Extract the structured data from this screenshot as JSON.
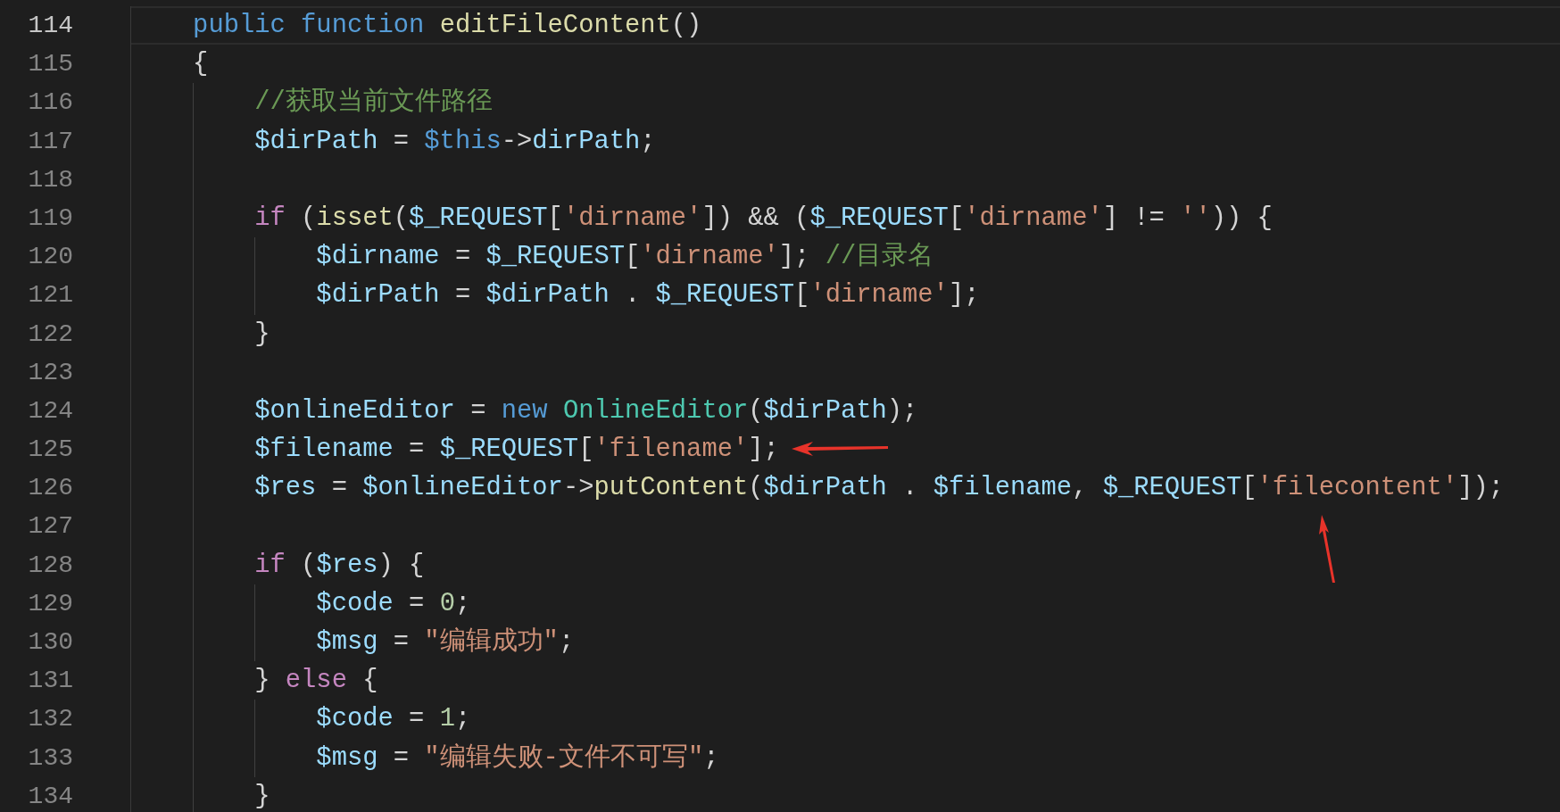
{
  "editor": {
    "lines": [
      {
        "number": "114",
        "current": true,
        "tokens": [
          {
            "text": "    public ",
            "kind": "kw"
          },
          {
            "text": "function ",
            "kind": "kw"
          },
          {
            "text": "editFileContent",
            "kind": "fn"
          },
          {
            "text": "()",
            "kind": "p"
          }
        ]
      },
      {
        "number": "115",
        "current": false,
        "tokens": [
          {
            "text": "    {",
            "kind": "p"
          }
        ]
      },
      {
        "number": "116",
        "current": false,
        "tokens": [
          {
            "text": "        //获取当前文件路径",
            "kind": "cmt"
          }
        ]
      },
      {
        "number": "117",
        "current": false,
        "tokens": [
          {
            "text": "        $dirPath",
            "kind": "var"
          },
          {
            "text": " = ",
            "kind": "p"
          },
          {
            "text": "$this",
            "kind": "kw"
          },
          {
            "text": "->",
            "kind": "p"
          },
          {
            "text": "dirPath",
            "kind": "var"
          },
          {
            "text": ";",
            "kind": "p"
          }
        ]
      },
      {
        "number": "118",
        "current": false
      },
      {
        "number": "119",
        "current": false,
        "tokens": [
          {
            "text": "        if",
            "kind": "ctl"
          },
          {
            "text": " (",
            "kind": "p"
          },
          {
            "text": "isset",
            "kind": "fn"
          },
          {
            "text": "(",
            "kind": "p"
          },
          {
            "text": "$_REQUEST",
            "kind": "var"
          },
          {
            "text": "[",
            "kind": "p"
          },
          {
            "text": "'dirname'",
            "kind": "str"
          },
          {
            "text": "]) && (",
            "kind": "p"
          },
          {
            "text": "$_REQUEST",
            "kind": "var"
          },
          {
            "text": "[",
            "kind": "p"
          },
          {
            "text": "'dirname'",
            "kind": "str"
          },
          {
            "text": "] != ",
            "kind": "p"
          },
          {
            "text": "''",
            "kind": "str"
          },
          {
            "text": ")) {",
            "kind": "p"
          }
        ]
      },
      {
        "number": "120",
        "current": false,
        "tokens": [
          {
            "text": "            $dirname",
            "kind": "var"
          },
          {
            "text": " = ",
            "kind": "p"
          },
          {
            "text": "$_REQUEST",
            "kind": "var"
          },
          {
            "text": "[",
            "kind": "p"
          },
          {
            "text": "'dirname'",
            "kind": "str"
          },
          {
            "text": "]; ",
            "kind": "p"
          },
          {
            "text": "//目录名",
            "kind": "cmt"
          }
        ]
      },
      {
        "number": "121",
        "current": false,
        "tokens": [
          {
            "text": "            $dirPath",
            "kind": "var"
          },
          {
            "text": " = ",
            "kind": "p"
          },
          {
            "text": "$dirPath",
            "kind": "var"
          },
          {
            "text": " . ",
            "kind": "p"
          },
          {
            "text": "$_REQUEST",
            "kind": "var"
          },
          {
            "text": "[",
            "kind": "p"
          },
          {
            "text": "'dirname'",
            "kind": "str"
          },
          {
            "text": "];",
            "kind": "p"
          }
        ]
      },
      {
        "number": "122",
        "current": false,
        "tokens": [
          {
            "text": "        }",
            "kind": "p"
          }
        ]
      },
      {
        "number": "123",
        "current": false
      },
      {
        "number": "124",
        "current": false,
        "tokens": [
          {
            "text": "        $onlineEditor",
            "kind": "var"
          },
          {
            "text": " = ",
            "kind": "p"
          },
          {
            "text": "new ",
            "kind": "kw"
          },
          {
            "text": "OnlineEditor",
            "kind": "cls"
          },
          {
            "text": "(",
            "kind": "p"
          },
          {
            "text": "$dirPath",
            "kind": "var"
          },
          {
            "text": ");",
            "kind": "p"
          }
        ]
      },
      {
        "number": "125",
        "current": false,
        "arrow_after": true,
        "tokens": [
          {
            "text": "        $filename",
            "kind": "var"
          },
          {
            "text": " = ",
            "kind": "p"
          },
          {
            "text": "$_REQUEST",
            "kind": "var"
          },
          {
            "text": "[",
            "kind": "p"
          },
          {
            "text": "'filename'",
            "kind": "str"
          },
          {
            "text": "];",
            "kind": "p"
          }
        ]
      },
      {
        "number": "126",
        "current": false,
        "tokens": [
          {
            "text": "        $res",
            "kind": "var"
          },
          {
            "text": " = ",
            "kind": "p"
          },
          {
            "text": "$onlineEditor",
            "kind": "var"
          },
          {
            "text": "->",
            "kind": "p"
          },
          {
            "text": "putContent",
            "kind": "fn"
          },
          {
            "text": "(",
            "kind": "p"
          },
          {
            "text": "$dirPath",
            "kind": "var"
          },
          {
            "text": " . ",
            "kind": "p"
          },
          {
            "text": "$filename",
            "kind": "var"
          },
          {
            "text": ", ",
            "kind": "p"
          },
          {
            "text": "$_REQUEST",
            "kind": "var"
          },
          {
            "text": "[",
            "kind": "p"
          },
          {
            "text": "'filecontent'",
            "kind": "str",
            "arrow_below": true
          },
          {
            "text": "]);",
            "kind": "p"
          }
        ]
      },
      {
        "number": "127",
        "current": false
      },
      {
        "number": "128",
        "current": false,
        "tokens": [
          {
            "text": "        if",
            "kind": "ctl"
          },
          {
            "text": " (",
            "kind": "p"
          },
          {
            "text": "$res",
            "kind": "var"
          },
          {
            "text": ") {",
            "kind": "p"
          }
        ]
      },
      {
        "number": "129",
        "current": false,
        "tokens": [
          {
            "text": "            $code",
            "kind": "var"
          },
          {
            "text": " = ",
            "kind": "p"
          },
          {
            "text": "0",
            "kind": "num"
          },
          {
            "text": ";",
            "kind": "p"
          }
        ]
      },
      {
        "number": "130",
        "current": false,
        "tokens": [
          {
            "text": "            $msg",
            "kind": "var"
          },
          {
            "text": " = ",
            "kind": "p"
          },
          {
            "text": "\"编辑成功\"",
            "kind": "str"
          },
          {
            "text": ";",
            "kind": "p"
          }
        ]
      },
      {
        "number": "131",
        "current": false,
        "tokens": [
          {
            "text": "        } ",
            "kind": "p"
          },
          {
            "text": "else",
            "kind": "ctl"
          },
          {
            "text": " {",
            "kind": "p"
          }
        ]
      },
      {
        "number": "132",
        "current": false,
        "tokens": [
          {
            "text": "            $code",
            "kind": "var"
          },
          {
            "text": " = ",
            "kind": "p"
          },
          {
            "text": "1",
            "kind": "num"
          },
          {
            "text": ";",
            "kind": "p"
          }
        ]
      },
      {
        "number": "133",
        "current": false,
        "tokens": [
          {
            "text": "            $msg",
            "kind": "var"
          },
          {
            "text": " = ",
            "kind": "p"
          },
          {
            "text": "\"编辑失败-文件不可写\"",
            "kind": "str"
          },
          {
            "text": ";",
            "kind": "p"
          }
        ]
      },
      {
        "number": "134",
        "current": false,
        "tokens": [
          {
            "text": "        }",
            "kind": "p"
          }
        ]
      }
    ]
  }
}
